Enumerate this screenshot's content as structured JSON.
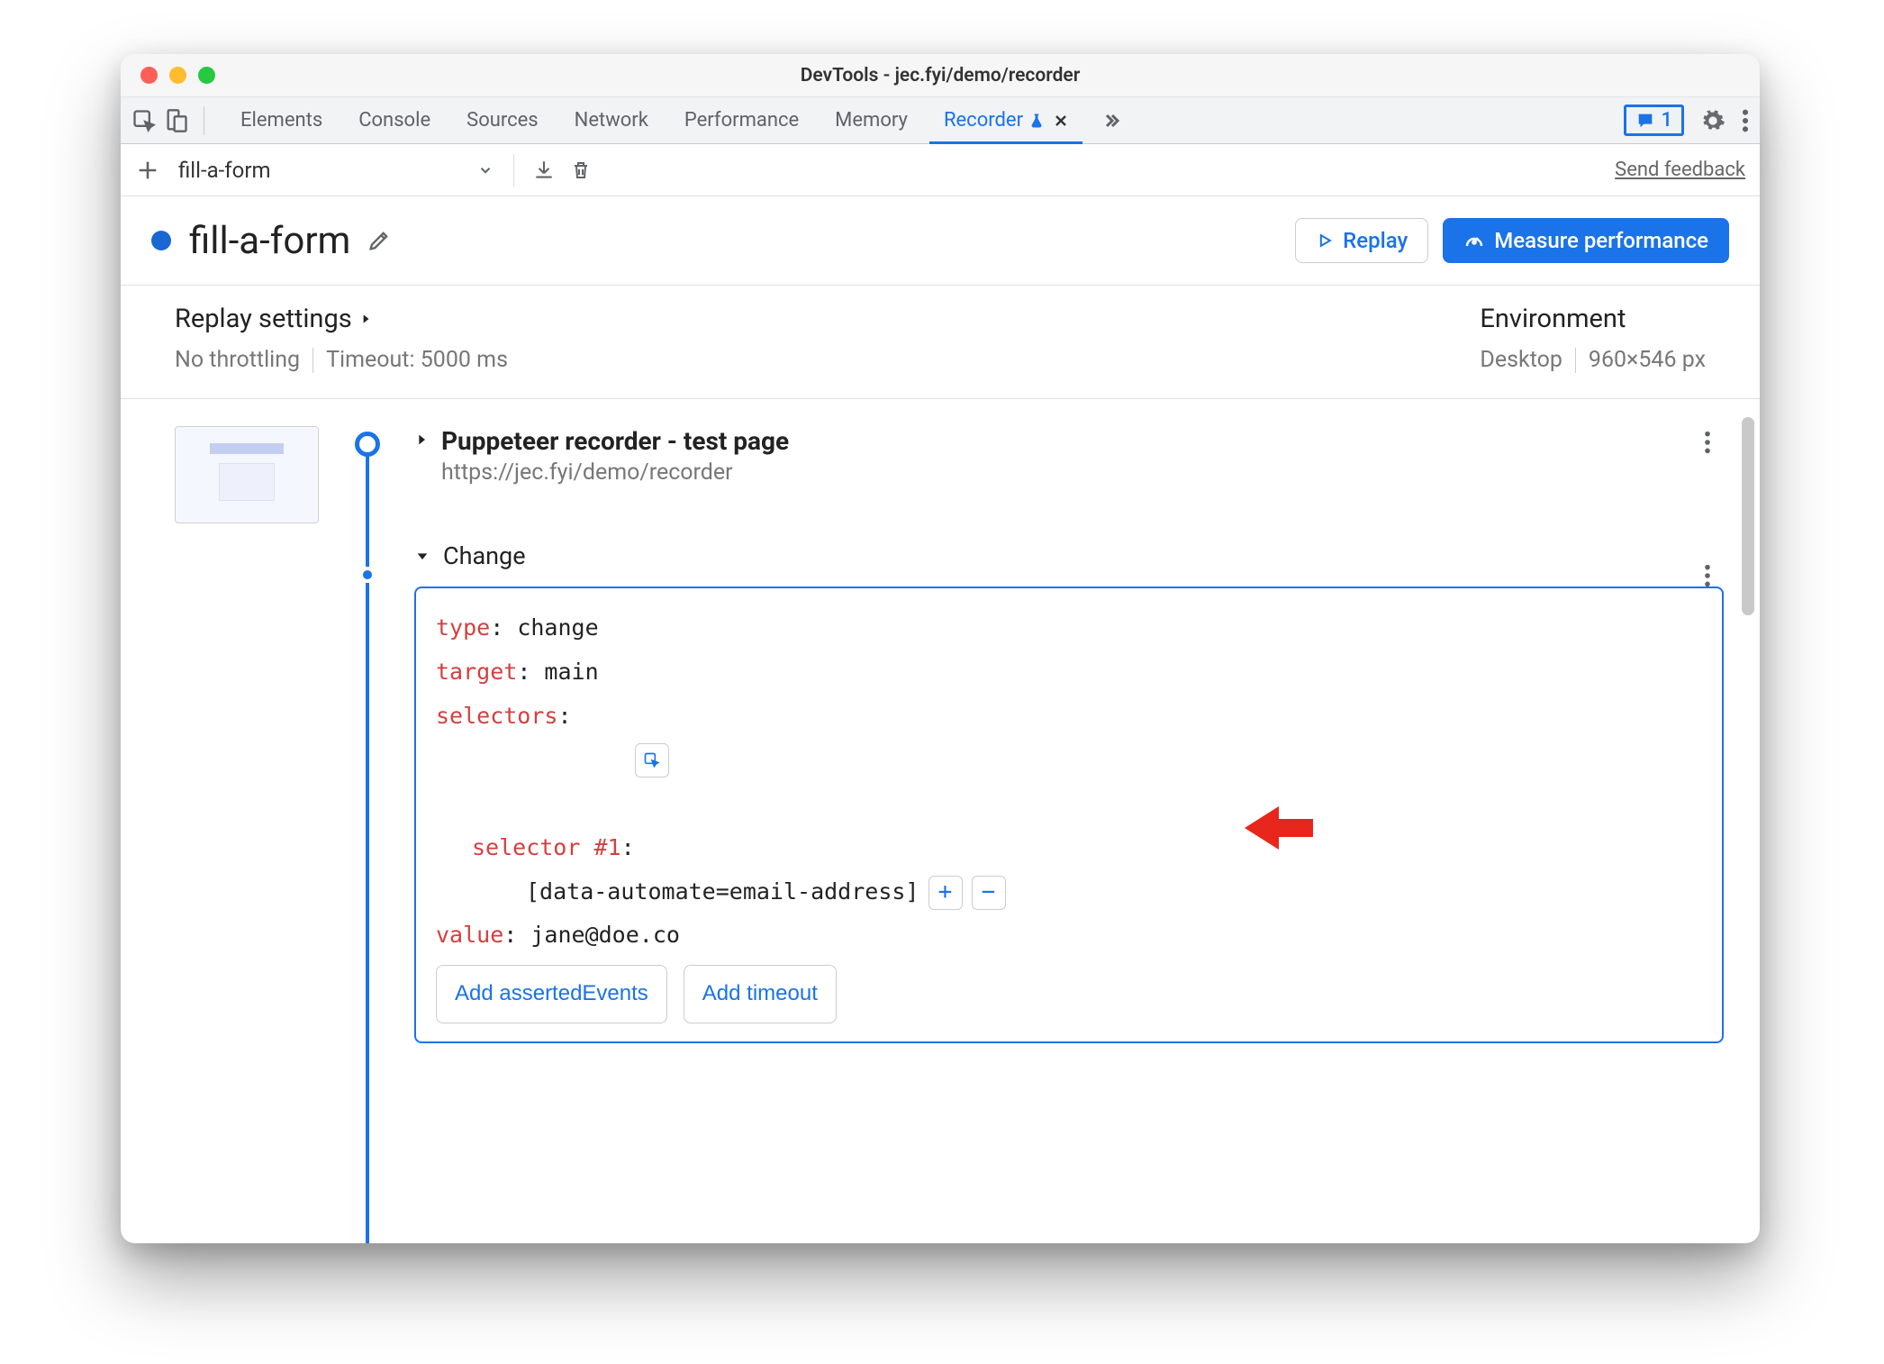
{
  "window": {
    "title": "DevTools - jec.fyi/demo/recorder"
  },
  "tabs": {
    "items": [
      "Elements",
      "Console",
      "Sources",
      "Network",
      "Performance",
      "Memory",
      "Recorder"
    ],
    "active": "Recorder",
    "issues_count": "1"
  },
  "toolbar": {
    "recording_name": "fill-a-form",
    "feedback": "Send feedback"
  },
  "header": {
    "title": "fill-a-form",
    "replay": "Replay",
    "measure": "Measure performance"
  },
  "settings": {
    "replay_title": "Replay settings",
    "throttling": "No throttling",
    "timeout": "Timeout: 5000 ms",
    "env_title": "Environment",
    "device": "Desktop",
    "dimensions": "960×546 px"
  },
  "steps": {
    "nav": {
      "title": "Puppeteer recorder - test page",
      "url": "https://jec.fyi/demo/recorder"
    },
    "change": {
      "label": "Change",
      "fields": {
        "type_key": "type",
        "type_val": "change",
        "target_key": "target",
        "target_val": "main",
        "selectors_key": "selectors",
        "sel1_key": "selector #1",
        "sel1_val": "[data-automate=email-address]",
        "value_key": "value",
        "value_val": "jane@doe.co"
      },
      "add_asserted": "Add assertedEvents",
      "add_timeout": "Add timeout"
    }
  }
}
